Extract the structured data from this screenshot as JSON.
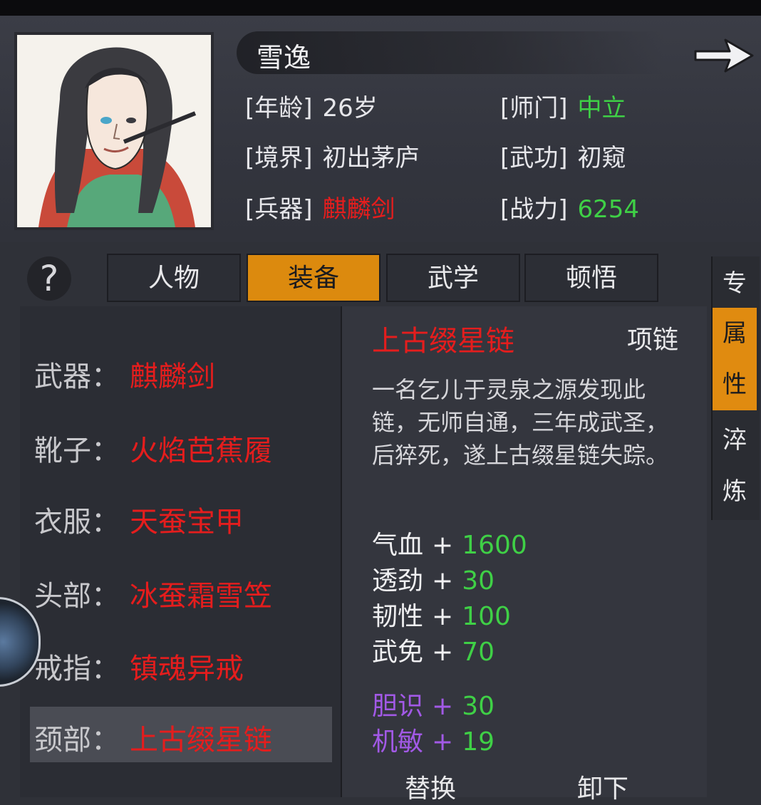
{
  "character": {
    "name": "雪逸",
    "age_label": "[年龄]",
    "age_value": "26岁",
    "sect_label": "[师门]",
    "sect_value": "中立",
    "realm_label": "[境界]",
    "realm_value": "初出茅庐",
    "kungfu_label": "[武功]",
    "kungfu_value": "初窥",
    "weapon_label": "[兵器]",
    "weapon_value": "麒麟剑",
    "power_label": "[战力]",
    "power_value": "6254"
  },
  "help_label": "?",
  "tabs": [
    {
      "label": "人物"
    },
    {
      "label": "装备"
    },
    {
      "label": "武学"
    },
    {
      "label": "顿悟"
    }
  ],
  "active_tab": "装备",
  "side_tabs": [
    "专",
    "属性",
    "淬炼"
  ],
  "side_tab_chars": {
    "zhuan": "专",
    "shu": "属",
    "xing": "性",
    "cui": "淬",
    "lian": "炼"
  },
  "equipment": [
    {
      "slot": "武器：",
      "item": "麒麟剑"
    },
    {
      "slot": "靴子：",
      "item": "火焰芭蕉履"
    },
    {
      "slot": "衣服：",
      "item": "天蚕宝甲"
    },
    {
      "slot": "头部：",
      "item": "冰蚕霜雪笠"
    },
    {
      "slot": "戒指：",
      "item": "镇魂异戒"
    },
    {
      "slot": "颈部：",
      "item": "上古缀星链"
    }
  ],
  "selected_item": {
    "name": "上古缀星链",
    "type": "项链",
    "description": "一名乞儿于灵泉之源发现此链，无师自通，三年成武圣，后猝死，遂上古缀星链失踪。",
    "stats": [
      {
        "name": "气血",
        "op": "+",
        "value": "1600"
      },
      {
        "name": "透劲",
        "op": "+",
        "value": "30"
      },
      {
        "name": "韧性",
        "op": "+",
        "value": "100"
      },
      {
        "name": "武免",
        "op": "+",
        "value": "70"
      }
    ],
    "bonus_stats": [
      {
        "name": "胆识",
        "op": "+",
        "value": "30"
      },
      {
        "name": "机敏",
        "op": "+",
        "value": "19"
      }
    ]
  },
  "actions": {
    "replace": "替换",
    "unequip": "卸下"
  },
  "colors": {
    "accent": "#dc8a0e",
    "rare_red": "#e51d1d",
    "stat_green": "#3fd046",
    "bonus_purple": "#a259e6"
  }
}
